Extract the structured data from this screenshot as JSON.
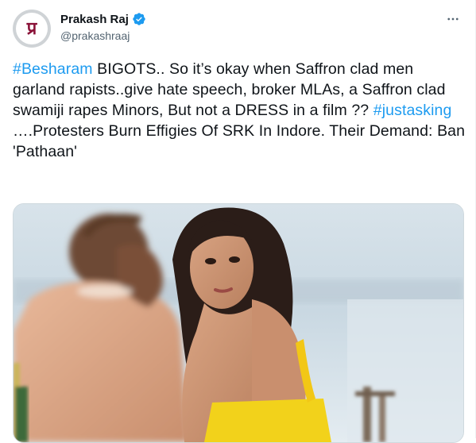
{
  "author": {
    "name": "Prakash Raj",
    "handle": "@prakashraaj",
    "avatar_text": "प्र",
    "verified": true
  },
  "tweet": {
    "hashtag1": "#Besharam",
    "text1": " BIGOTS.. So it’s okay when Saffron clad men garland rapists..give hate speech, broker MLAs, a Saffron clad swamiji rapes Minors, But not a DRESS in a film ?? ",
    "hashtag2": "#justasking",
    "text2": "\n….Protesters Burn Effigies Of SRK In Indore. Their Demand: Ban 'Pathaan'"
  },
  "icons": {
    "more": "more-horizontal-icon",
    "verified": "verified-badge-icon"
  },
  "colors": {
    "link": "#1d9bf0",
    "text": "#0f1419",
    "secondary": "#536471"
  }
}
